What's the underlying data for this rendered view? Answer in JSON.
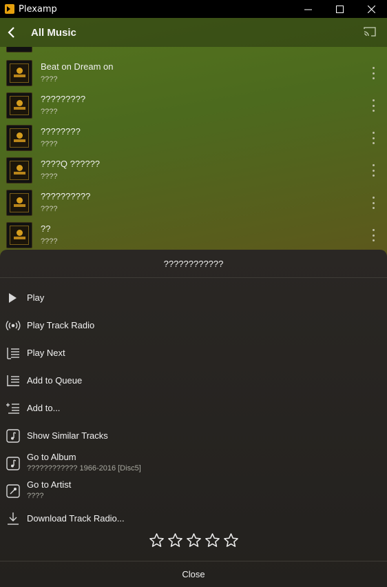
{
  "window": {
    "title": "Plexamp",
    "minimize_glyph": "—",
    "maximize_glyph": "☐",
    "close_glyph": "✕"
  },
  "header": {
    "title": "All Music",
    "back_icon": "chevron-left-icon",
    "cast_icon": "cast-icon"
  },
  "partial_track": {
    "artist": "????"
  },
  "tracks": [
    {
      "title": "Beat on Dream on",
      "artist": "????"
    },
    {
      "title": "?????????",
      "artist": "????"
    },
    {
      "title": "????????",
      "artist": "????"
    },
    {
      "title": "????Q ??????",
      "artist": "????"
    },
    {
      "title": "??????????",
      "artist": "????"
    },
    {
      "title": "??",
      "artist": "????"
    }
  ],
  "sheet": {
    "title": "????????????",
    "items": [
      {
        "label": "Play",
        "icon": "play-icon"
      },
      {
        "label": "Play Track Radio",
        "icon": "radio-icon"
      },
      {
        "label": "Play Next",
        "icon": "play-next-icon"
      },
      {
        "label": "Add to Queue",
        "icon": "add-to-queue-icon"
      },
      {
        "label": "Add to...",
        "icon": "add-to-icon"
      },
      {
        "label": "Show Similar Tracks",
        "icon": "music-note-icon"
      },
      {
        "label": "Go to Album",
        "sub": "???????????? 1966-2016 [Disc5]",
        "icon": "album-icon"
      },
      {
        "label": "Go to Artist",
        "sub": "????",
        "icon": "artist-icon"
      },
      {
        "label": "Download Track Radio...",
        "icon": "download-icon"
      }
    ],
    "rating": {
      "stars": 5,
      "filled": 0
    },
    "close_label": "Close"
  }
}
